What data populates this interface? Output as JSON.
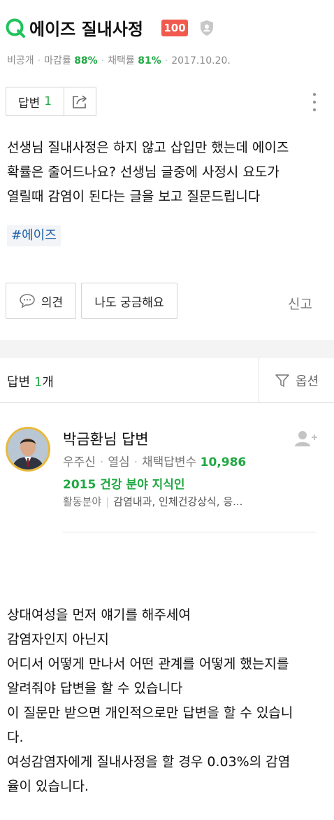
{
  "question": {
    "title": "에이즈 질내사정",
    "points": "100",
    "meta": {
      "visibility": "비공개",
      "closing_label": "마감률",
      "closing_value": "88%",
      "adoption_label": "채택률",
      "adoption_value": "81%",
      "date": "2017.10.20."
    },
    "answer_label": "답변",
    "answer_count": "1",
    "body_lines": [
      "선생님 질내사정은 하지 않고 삽입만 했는데 에이즈",
      "확률은 줄어드나요? 선생님 글중에 사정시 요도가",
      "열릴때 감염이 된다는 글을 보고 질문드립니다"
    ],
    "tag": "#에이즈",
    "opinion_label": "의견",
    "curious_label": "나도 궁금해요",
    "report_label": "신고"
  },
  "answers_header": {
    "label": "답변",
    "count": "1",
    "unit": "개",
    "options_label": "옵션"
  },
  "answerer": {
    "name": "박금환님 답변",
    "grade": "우주신",
    "status": "열심",
    "adopted_label": "채택답변수",
    "adopted_count": "10,986",
    "expert": "2015 건강 분야 지식인",
    "field_label": "활동분야",
    "fields": "감염내과, 인체건강상식, 응..."
  },
  "answer_body_lines": [
    "상대여성을 먼저 얘기를 해주세여",
    "감염자인지 아닌지",
    "어디서 어떻게 만나서 어떤 관계를 어떻게 했는지를",
    "알려줘야 답변을 할 수 있습니다",
    "이 질문만 받으면 개인적으로만 답변을 할 수 있습니",
    "다.",
    "여성감염자에게 질내사정을 할 경우 0.03%의 감염",
    "율이 있습니다."
  ],
  "icons": {
    "question": "q-icon",
    "privacy": "shield-icon",
    "share": "share-icon",
    "more": "kebab-icon",
    "comment": "comment-icon",
    "filter": "filter-icon",
    "add_friend": "add-person-icon"
  },
  "colors": {
    "accent_green": "#21a843",
    "points_red": "#f0594b",
    "tag_blue": "#1a5fa8"
  }
}
